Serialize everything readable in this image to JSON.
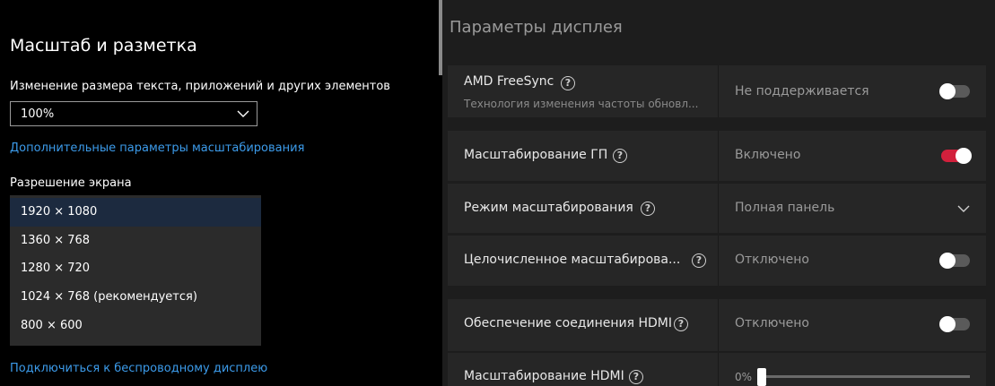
{
  "windows": {
    "section_title": "Масштаб и разметка",
    "scale_label": "Изменение размера текста, приложений и других элементов",
    "scale_value": "100%",
    "advanced_scaling_link": "Дополнительные параметры масштабирования",
    "resolution_label": "Разрешение экрана",
    "resolutions": [
      {
        "label": "1920 × 1080",
        "selected": true
      },
      {
        "label": "1360 × 768",
        "selected": false
      },
      {
        "label": "1280 × 720",
        "selected": false
      },
      {
        "label": "1024 × 768 (рекомендуется)",
        "selected": false
      },
      {
        "label": "800 × 600",
        "selected": false
      }
    ],
    "wireless_link": "Подключиться к беспроводному дисплею"
  },
  "amd": {
    "section_title": "Параметры дисплея",
    "rows": [
      {
        "label": "AMD FreeSync",
        "sub": "Технология изменения частоты обновл...",
        "value": "Не поддерживается",
        "control": "toggle",
        "on": false
      },
      {
        "label": "Масштабирование ГП",
        "value": "Включено",
        "control": "toggle",
        "on": true
      },
      {
        "label": "Режим масштабирования",
        "value": "Полная панель",
        "control": "dropdown"
      },
      {
        "label": "Целочисленное масштабирова...",
        "value": "Отключено",
        "control": "toggle",
        "on": false
      },
      {
        "label": "Обеспечение соединения HDMI",
        "value": "Отключено",
        "control": "toggle",
        "on": false
      },
      {
        "label": "Масштабирование HDMI",
        "value": "0%",
        "control": "slider",
        "level": 0
      }
    ],
    "help_glyph": "?"
  },
  "colors": {
    "link": "#3c9bea",
    "toggle_on": "#d2203c",
    "selected_item": "#1c2a3f"
  }
}
